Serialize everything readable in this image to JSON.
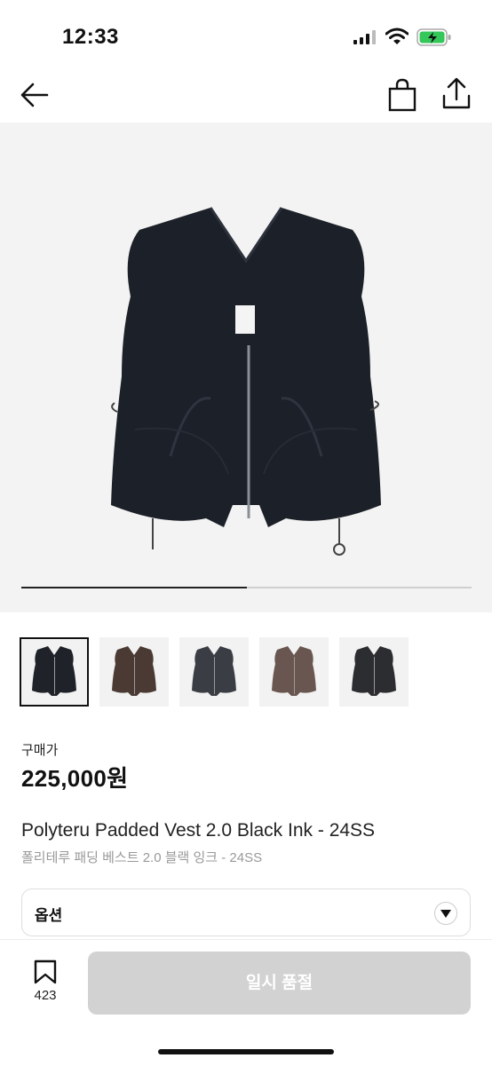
{
  "status_bar": {
    "time": "12:33"
  },
  "hero": {
    "progress_fraction": 0.5
  },
  "thumbnails": [
    {
      "color_name": "black ink",
      "color": "#1f2329",
      "selected": true
    },
    {
      "color_name": "brown",
      "color": "#4a3a33",
      "selected": false
    },
    {
      "color_name": "charcoal",
      "color": "#3a3d44",
      "selected": false
    },
    {
      "color_name": "taupe",
      "color": "#6a5650",
      "selected": false
    },
    {
      "color_name": "dark grey",
      "color": "#2c2d30",
      "selected": false
    }
  ],
  "product": {
    "price_label": "구매가",
    "price": "225,000원",
    "name_en": "Polyteru Padded Vest 2.0 Black Ink - 24SS",
    "name_ko": "폴리테루 패딩 베스트 2.0 블랙 잉크 - 24SS"
  },
  "option": {
    "label": "옵션"
  },
  "bottom": {
    "bookmark_count": "423",
    "button_label": "일시 품절"
  },
  "colors": {
    "button_disabled": "#d2d2d2",
    "vest": "#1c2028"
  }
}
